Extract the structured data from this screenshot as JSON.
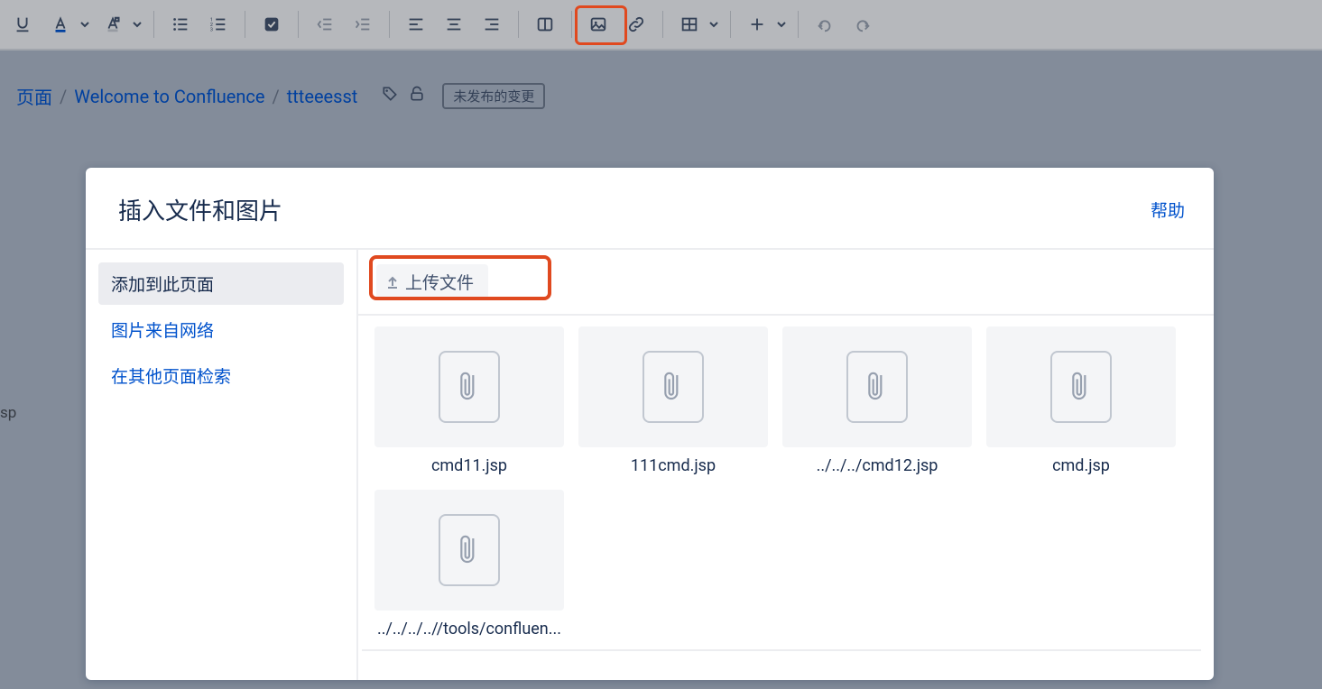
{
  "toolbar": {
    "buttons": [
      "underline",
      "text-color",
      "highlight-color",
      "sep",
      "bullet-list",
      "number-list",
      "sep",
      "action-item",
      "sep",
      "outdent",
      "indent",
      "sep",
      "align-left",
      "align-center",
      "align-right",
      "sep",
      "layout",
      "sep",
      "image",
      "link",
      "sep",
      "table",
      "sep",
      "insert",
      "sep",
      "undo",
      "redo"
    ]
  },
  "breadcrumb": {
    "items": [
      "页面",
      "Welcome to Confluence",
      "ttteeesst"
    ],
    "badge": "未发布的变更"
  },
  "leftSnippet": "sp",
  "modal": {
    "title": "插入文件和图片",
    "help": "帮助",
    "sidebar": {
      "items": [
        {
          "label": "添加到此页面",
          "active": true
        },
        {
          "label": "图片来自网络",
          "active": false
        },
        {
          "label": "在其他页面检索",
          "active": false
        }
      ]
    },
    "uploadLabel": "上传文件",
    "files": [
      {
        "name": "cmd11.jsp"
      },
      {
        "name": "111cmd.jsp"
      },
      {
        "name": "../../../cmd12.jsp"
      },
      {
        "name": "cmd.jsp"
      },
      {
        "name": "../../../..//tools/confluen..."
      }
    ]
  }
}
